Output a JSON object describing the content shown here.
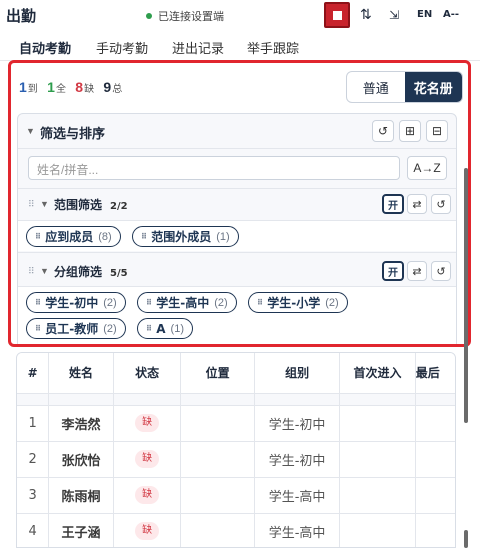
{
  "header": {
    "title": "出勤",
    "connection_status": "已连接设置端",
    "connection_color": "#2e9d4d",
    "sort_icon": "⇅",
    "collapse_icon": "⇲",
    "lang": "EN",
    "font_size": "A--"
  },
  "tabs": [
    "自动考勤",
    "手动考勤",
    "进出记录",
    "举手跟踪"
  ],
  "summary": {
    "arrived_count": "1",
    "arrived_label": "到",
    "full_count": "1",
    "full_label": "全",
    "absent_count": "8",
    "absent_label": "缺",
    "total_count": "9",
    "total_label": "总"
  },
  "view_toggle": {
    "normal": "普通",
    "roster": "花名册"
  },
  "filter": {
    "title": "筛选与排序",
    "search_placeholder": "姓名/拼音...",
    "sort_label": "A→Z",
    "scope": {
      "title": "范围筛选",
      "count": "2/2",
      "on_label": "开",
      "chips": [
        {
          "label": "应到成员",
          "count": "(8)"
        },
        {
          "label": "范围外成员",
          "count": "(1)"
        }
      ]
    },
    "group": {
      "title": "分组筛选",
      "count": "5/5",
      "on_label": "开",
      "chips": [
        {
          "label": "学生-初中",
          "count": "(2)"
        },
        {
          "label": "学生-高中",
          "count": "(2)"
        },
        {
          "label": "学生-小学",
          "count": "(2)"
        },
        {
          "label": "员工-教师",
          "count": "(2)"
        },
        {
          "label": "A",
          "count": "(1)"
        }
      ]
    }
  },
  "table": {
    "columns": [
      "#",
      "姓名",
      "状态",
      "位置",
      "组别",
      "首次进入",
      "最后"
    ],
    "rows": [
      {
        "num": "1",
        "name": "李浩然",
        "status": "缺",
        "location": "",
        "group": "学生-初中",
        "first": "",
        "last": ""
      },
      {
        "num": "2",
        "name": "张欣怡",
        "status": "缺",
        "location": "",
        "group": "学生-初中",
        "first": "",
        "last": ""
      },
      {
        "num": "3",
        "name": "陈雨桐",
        "status": "缺",
        "location": "",
        "group": "学生-高中",
        "first": "",
        "last": ""
      },
      {
        "num": "4",
        "name": "王子涵",
        "status": "缺",
        "location": "",
        "group": "学生-高中",
        "first": "",
        "last": ""
      }
    ]
  }
}
